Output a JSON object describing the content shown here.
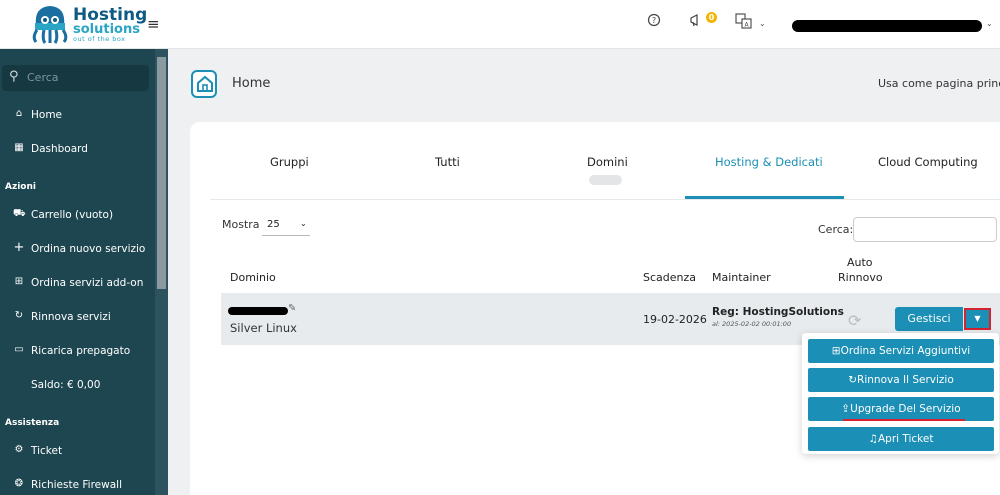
{
  "header": {
    "logo": {
      "line1": "Hosting",
      "line2": "solutions",
      "tagline": "out of the box"
    },
    "notification_count": "0",
    "icons": [
      "menu-icon",
      "help-icon",
      "megaphone-icon",
      "translate-icon",
      "chevron-down-icon"
    ]
  },
  "sidebar": {
    "search_placeholder": "Cerca",
    "items": [
      {
        "label": "Home",
        "icon": "home-icon"
      },
      {
        "label": "Dashboard",
        "icon": "dashboard-icon"
      },
      {
        "label": "Carrello (vuoto)",
        "icon": "cart-icon"
      },
      {
        "label": "Ordina nuovo servizio",
        "icon": "plus-icon"
      },
      {
        "label": "Ordina servizi add-on",
        "icon": "plus-square-icon"
      },
      {
        "label": "Rinnova servizi",
        "icon": "refresh-icon"
      },
      {
        "label": "Ricarica prepagato",
        "icon": "money-icon"
      },
      {
        "label": "Saldo: € 0,00",
        "icon": ""
      },
      {
        "label": "Ticket",
        "icon": "gear-icon"
      },
      {
        "label": "Richieste Firewall",
        "icon": "firewall-icon"
      }
    ],
    "sections": {
      "azioni": "Azioni",
      "assistenza": "Assistenza"
    }
  },
  "page": {
    "title": "Home",
    "use_as_home": "Usa come pagina princip"
  },
  "tabs": [
    {
      "label": "Gruppi",
      "active": false
    },
    {
      "label": "Tutti",
      "active": false
    },
    {
      "label": "Domini",
      "active": false
    },
    {
      "label": "Hosting & Dedicati",
      "active": true
    },
    {
      "label": "Cloud Computing",
      "active": false
    }
  ],
  "table_controls": {
    "show_label": "Mostra",
    "page_size": "25",
    "search_label": "Cerca:"
  },
  "table": {
    "headers": {
      "domain": "Dominio",
      "expiry": "Scadenza",
      "maintainer": "Maintainer",
      "auto_renew_1": "Auto",
      "auto_renew_2": "Rinnovo"
    },
    "rows": [
      {
        "product": "Silver Linux",
        "expiry": "19-02-2026",
        "maintainer": "Reg: HostingSolutions",
        "maintainer_date": "al: 2025-02-02 00:01:00"
      }
    ]
  },
  "actions": {
    "manage": "Gestisci",
    "dropdown": [
      "Ordina Servizi Aggiuntivi",
      "Rinnova Il Servizio",
      "Upgrade Del Servizio",
      "Apri Ticket"
    ]
  },
  "colors": {
    "accent": "#1b8fb5",
    "sidebar": "#1e4650",
    "highlight": "#d3232f"
  }
}
